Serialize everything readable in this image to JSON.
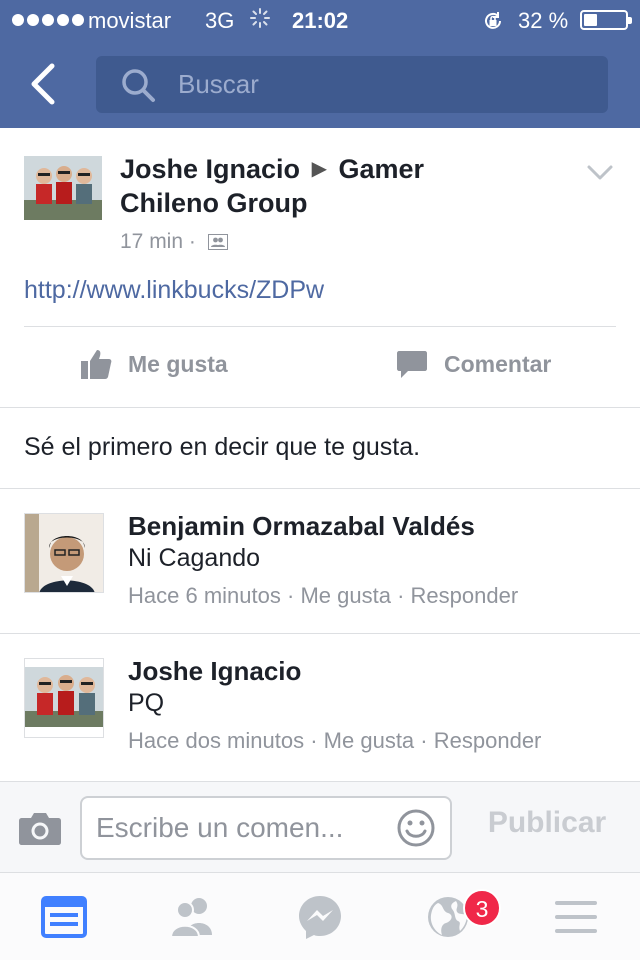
{
  "status_bar": {
    "carrier": "movistar",
    "network": "3G",
    "time": "21:02",
    "battery_percent_label": "32 %",
    "battery_level": 0.32
  },
  "nav": {
    "search_placeholder": "Buscar"
  },
  "post": {
    "author_line1": "Joshe Ignacio",
    "author_arrow": "▶",
    "author_line1_group": "Gamer",
    "author_line2": "Chileno Group",
    "time": "17 min",
    "time_separator": "·",
    "link": "http://www.linkbucks/ZDPw",
    "actions": {
      "like_label": "Me gusta",
      "comment_label": "Comentar"
    }
  },
  "likes_prompt": "Sé el primero en decir que te gusta.",
  "comments": [
    {
      "name": "Benjamin Ormazabal Valdés",
      "text": "Ni Cagando",
      "time": "Hace 6 minutos",
      "like": "Me gusta",
      "reply": "Responder",
      "separator": "·"
    },
    {
      "name": "Joshe Ignacio",
      "text": "PQ",
      "time": "Hace dos minutos",
      "like": "Me gusta",
      "reply": "Responder",
      "separator": "·"
    }
  ],
  "composer": {
    "placeholder": "Escribe un comen...",
    "publish_label": "Publicar"
  },
  "tabbar": {
    "notifications_badge": "3"
  },
  "colors": {
    "brand": "#4e69a2",
    "search_field": "#3f5a8f",
    "secondary_text": "#90949c",
    "badge": "#f02849",
    "active_tab": "#4080ff"
  }
}
